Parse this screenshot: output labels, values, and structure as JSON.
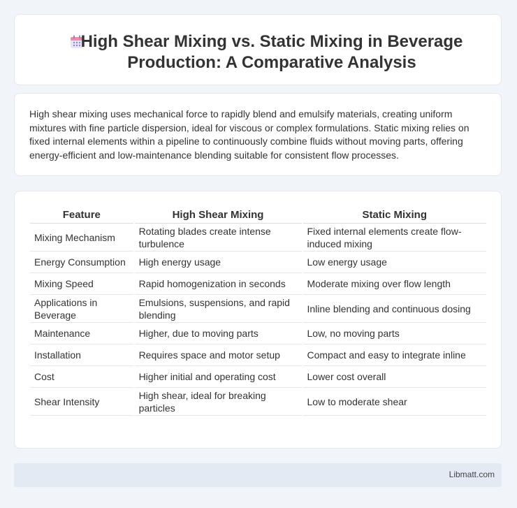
{
  "header": {
    "title": "High Shear Mixing vs. Static Mixing in Beverage Production: A Comparative Analysis",
    "icon": "calendar-icon"
  },
  "intro": {
    "text": "High shear mixing uses mechanical force to rapidly blend and emulsify materials, creating uniform mixtures with fine particle dispersion, ideal for viscous or complex formulations. Static mixing relies on fixed internal elements within a pipeline to continuously combine fluids without moving parts, offering energy-efficient and low-maintenance blending suitable for consistent flow processes."
  },
  "table": {
    "headers": [
      "Feature",
      "High Shear Mixing",
      "Static Mixing"
    ],
    "rows": [
      [
        "Mixing Mechanism",
        "Rotating blades create intense turbulence",
        "Fixed internal elements create flow-induced mixing"
      ],
      [
        "Energy Consumption",
        "High energy usage",
        "Low energy usage"
      ],
      [
        "Mixing Speed",
        "Rapid homogenization in seconds",
        "Moderate mixing over flow length"
      ],
      [
        "Applications in Beverage",
        "Emulsions, suspensions, and rapid blending",
        "Inline blending and continuous dosing"
      ],
      [
        "Maintenance",
        "Higher, due to moving parts",
        "Low, no moving parts"
      ],
      [
        "Installation",
        "Requires space and motor setup",
        "Compact and easy to integrate inline"
      ],
      [
        "Cost",
        "Higher initial and operating cost",
        "Lower cost overall"
      ],
      [
        "Shear Intensity",
        "High shear, ideal for breaking particles",
        "Low to moderate shear"
      ]
    ]
  },
  "footer": {
    "text": "Libmatt.com"
  }
}
